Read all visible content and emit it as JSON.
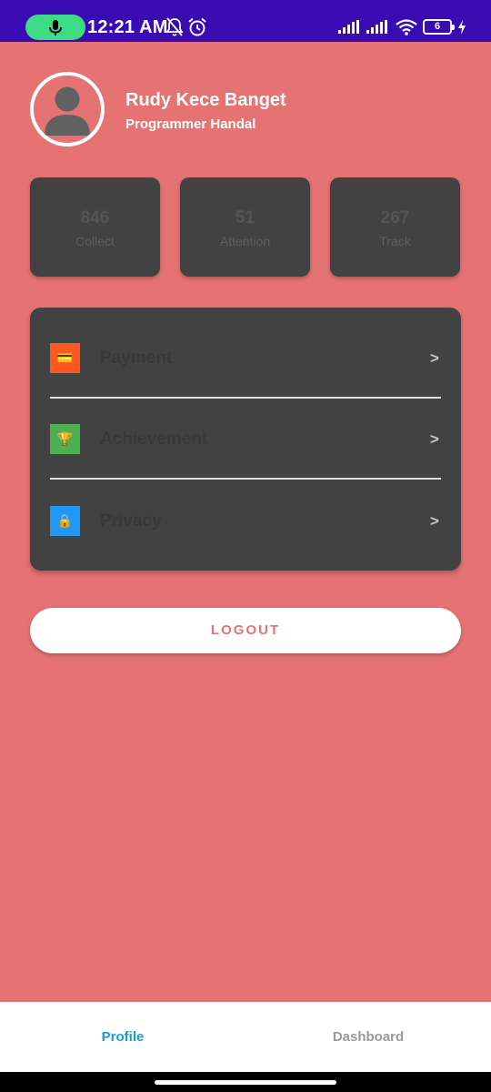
{
  "status_bar": {
    "time": "12:21 AM",
    "battery": "6",
    "icons": [
      "mic-icon",
      "bell-off-icon",
      "alarm-icon",
      "signal-icon",
      "signal-icon",
      "wifi-icon",
      "battery-icon",
      "charging-icon"
    ]
  },
  "profile": {
    "name": "Rudy Kece Banget",
    "role": "Programmer Handal",
    "avatar_icon": "user-icon"
  },
  "stats": [
    {
      "value": "846",
      "label": "Collect"
    },
    {
      "value": "51",
      "label": "Attention"
    },
    {
      "value": "267",
      "label": "Track"
    }
  ],
  "menu": [
    {
      "label": "Payment",
      "icon": "credit-card-icon",
      "glyph": "💳",
      "color": "#ff5722",
      "chevron": ">"
    },
    {
      "label": "Achievement",
      "icon": "trophy-icon",
      "glyph": "🏆",
      "color": "#4caf50",
      "chevron": ">"
    },
    {
      "label": "Privacy",
      "icon": "lock-icon",
      "glyph": "🔒",
      "color": "#2196f3",
      "chevron": ">"
    }
  ],
  "logout_label": "LOGOUT",
  "bottom_nav": {
    "tabs": [
      {
        "label": "Profile",
        "active": true
      },
      {
        "label": "Dashboard",
        "active": false
      }
    ]
  },
  "colors": {
    "background": "#e57373",
    "card": "#424242",
    "status_bar": "#3a0ab3",
    "active_tab": "#1e9ccc",
    "mic_pill": "#3ddc84"
  }
}
